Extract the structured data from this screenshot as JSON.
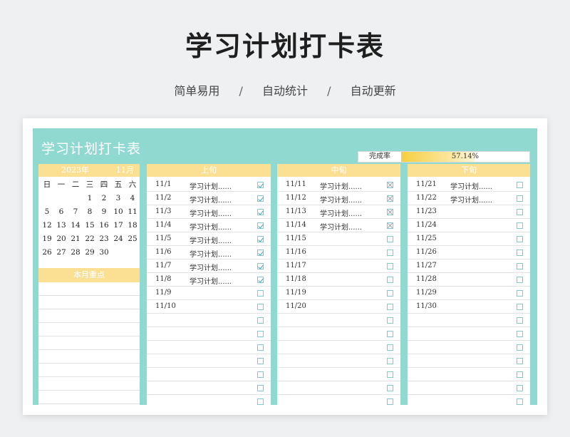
{
  "header": {
    "title": "学习计划打卡表",
    "subtitle_items": [
      "简单易用",
      "自动统计",
      "自动更新"
    ],
    "separator": "/"
  },
  "sheet": {
    "title": "学习计划打卡表",
    "completion_label": "完成率",
    "completion_value": "57.14%",
    "completion_fraction": 0.5714
  },
  "calendar": {
    "year_label": "2023年",
    "month_label": "11月",
    "weekdays": [
      "日",
      "一",
      "二",
      "三",
      "四",
      "五",
      "六"
    ],
    "weeks": [
      [
        "",
        "",
        "",
        "1",
        "2",
        "3",
        "4"
      ],
      [
        "5",
        "6",
        "7",
        "8",
        "9",
        "10",
        "11"
      ],
      [
        "12",
        "13",
        "14",
        "15",
        "16",
        "17",
        "18"
      ],
      [
        "19",
        "20",
        "21",
        "22",
        "23",
        "24",
        "25"
      ],
      [
        "26",
        "27",
        "28",
        "29",
        "30",
        "",
        ""
      ]
    ],
    "focus_label": "本月重点"
  },
  "sections": [
    {
      "header": "上旬",
      "rows": [
        {
          "date": "11/1",
          "task": "学习计划......",
          "state": "checked"
        },
        {
          "date": "11/2",
          "task": "学习计划......",
          "state": "checked"
        },
        {
          "date": "11/3",
          "task": "学习计划......",
          "state": "checked"
        },
        {
          "date": "11/4",
          "task": "学习计划......",
          "state": "checked"
        },
        {
          "date": "11/5",
          "task": "学习计划......",
          "state": "checked"
        },
        {
          "date": "11/6",
          "task": "学习计划......",
          "state": "checked"
        },
        {
          "date": "11/7",
          "task": "学习计划......",
          "state": "checked"
        },
        {
          "date": "11/8",
          "task": "学习计划......",
          "state": "checked"
        },
        {
          "date": "11/9",
          "task": "",
          "state": "empty"
        },
        {
          "date": "11/10",
          "task": "",
          "state": "empty"
        },
        {
          "date": "",
          "task": "",
          "state": "empty"
        },
        {
          "date": "",
          "task": "",
          "state": "empty"
        },
        {
          "date": "",
          "task": "",
          "state": "empty"
        },
        {
          "date": "",
          "task": "",
          "state": "empty"
        },
        {
          "date": "",
          "task": "",
          "state": "empty"
        },
        {
          "date": "",
          "task": "",
          "state": "empty"
        },
        {
          "date": "",
          "task": "",
          "state": "empty"
        }
      ]
    },
    {
      "header": "中旬",
      "rows": [
        {
          "date": "11/11",
          "task": "学习计划......",
          "state": "crossed"
        },
        {
          "date": "11/12",
          "task": "学习计划......",
          "state": "crossed"
        },
        {
          "date": "11/13",
          "task": "学习计划......",
          "state": "crossed"
        },
        {
          "date": "11/14",
          "task": "学习计划......",
          "state": "crossed"
        },
        {
          "date": "11/15",
          "task": "",
          "state": "empty"
        },
        {
          "date": "11/16",
          "task": "",
          "state": "empty"
        },
        {
          "date": "11/17",
          "task": "",
          "state": "empty"
        },
        {
          "date": "11/18",
          "task": "",
          "state": "empty"
        },
        {
          "date": "11/19",
          "task": "",
          "state": "empty"
        },
        {
          "date": "11/20",
          "task": "",
          "state": "empty"
        },
        {
          "date": "",
          "task": "",
          "state": "empty"
        },
        {
          "date": "",
          "task": "",
          "state": "empty"
        },
        {
          "date": "",
          "task": "",
          "state": "empty"
        },
        {
          "date": "",
          "task": "",
          "state": "empty"
        },
        {
          "date": "",
          "task": "",
          "state": "empty"
        },
        {
          "date": "",
          "task": "",
          "state": "empty"
        },
        {
          "date": "",
          "task": "",
          "state": "empty"
        }
      ]
    },
    {
      "header": "下旬",
      "rows": [
        {
          "date": "11/21",
          "task": "学习计划......",
          "state": "empty"
        },
        {
          "date": "11/22",
          "task": "学习计划......",
          "state": "empty"
        },
        {
          "date": "11/23",
          "task": "",
          "state": "empty"
        },
        {
          "date": "11/24",
          "task": "",
          "state": "empty"
        },
        {
          "date": "11/25",
          "task": "",
          "state": "empty"
        },
        {
          "date": "11/26",
          "task": "",
          "state": "empty"
        },
        {
          "date": "11/27",
          "task": "",
          "state": "empty"
        },
        {
          "date": "11/28",
          "task": "",
          "state": "empty"
        },
        {
          "date": "11/29",
          "task": "",
          "state": "empty"
        },
        {
          "date": "11/30",
          "task": "",
          "state": "empty"
        },
        {
          "date": "",
          "task": "",
          "state": "empty"
        },
        {
          "date": "",
          "task": "",
          "state": "empty"
        },
        {
          "date": "",
          "task": "",
          "state": "empty"
        },
        {
          "date": "",
          "task": "",
          "state": "empty"
        },
        {
          "date": "",
          "task": "",
          "state": "empty"
        },
        {
          "date": "",
          "task": "",
          "state": "empty"
        },
        {
          "date": "",
          "task": "",
          "state": "empty"
        }
      ]
    }
  ],
  "colors": {
    "panel_teal": "#8fd9d1",
    "header_yellow": "#fbe094",
    "progress_gold": "#f6cf3f",
    "checkbox_border": "#7fc9cf",
    "check_mark": "#3aa7b8"
  }
}
